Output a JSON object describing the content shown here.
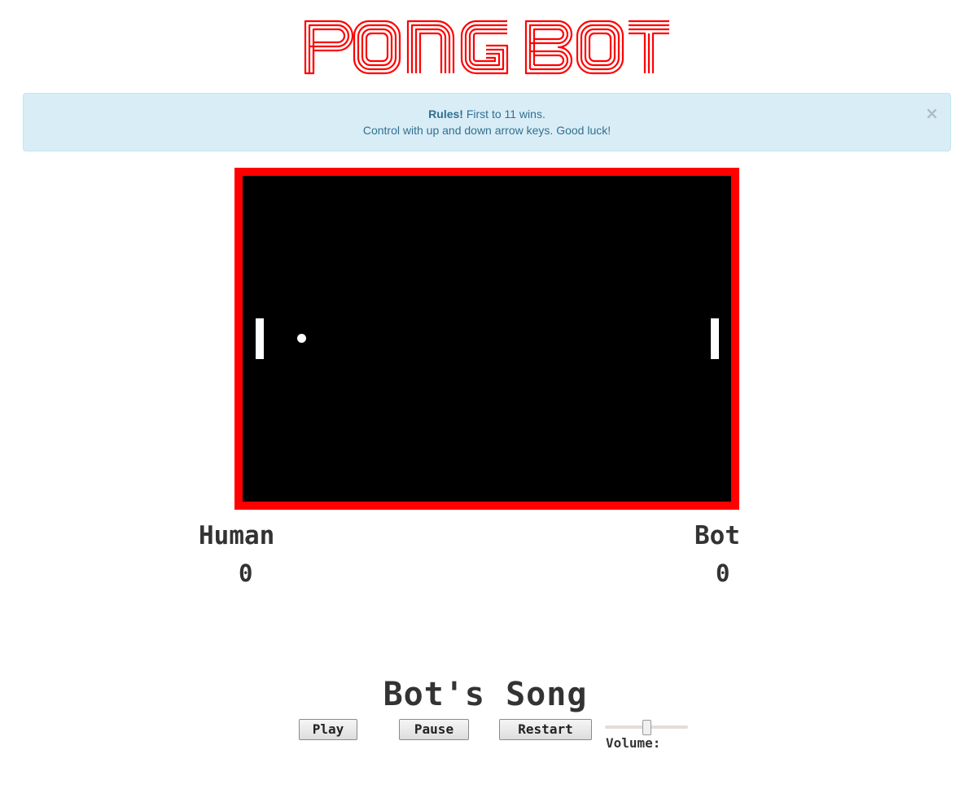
{
  "header": {
    "logo_text": "PongBot",
    "logo_color": "#ff0000"
  },
  "alert": {
    "rules_label": "Rules!",
    "line1_rest": " First to 11 wins.",
    "line2": "Control with up and down arrow keys. Good luck!",
    "close_glyph": "×"
  },
  "game": {
    "border_color": "#ff0000",
    "background_color": "#000000",
    "ball_color": "#ffffff"
  },
  "scoreboard": {
    "human": {
      "name": "Human",
      "score": "0"
    },
    "bot": {
      "name": "Bot",
      "score": "0"
    }
  },
  "song": {
    "title": "Bot's Song",
    "play_label": "Play",
    "pause_label": "Pause",
    "restart_label": "Restart",
    "volume_label": "Volume:",
    "volume_level": 0.5
  }
}
